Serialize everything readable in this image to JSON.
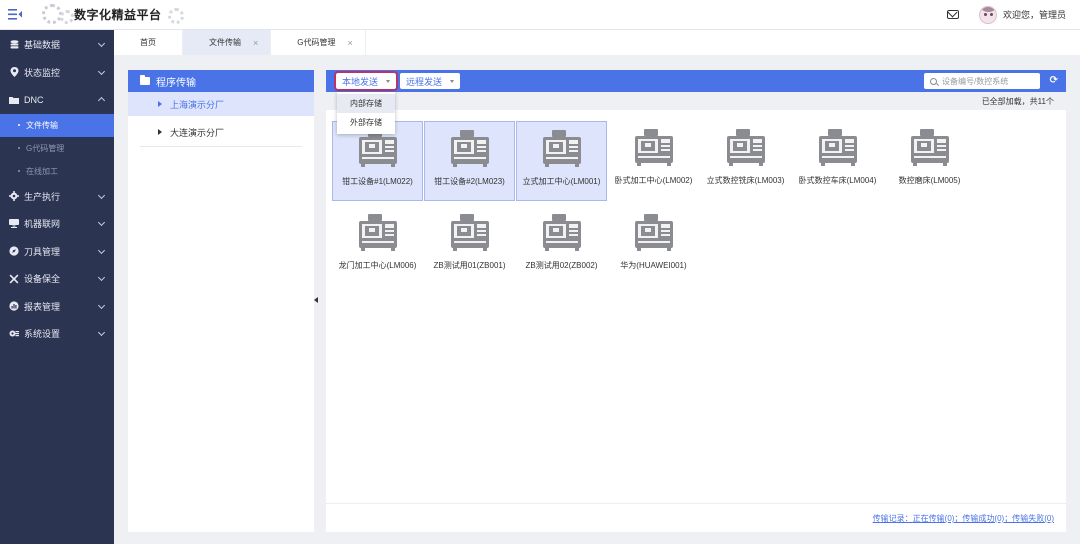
{
  "header": {
    "app_title": "数字化精益平台",
    "welcome": "欢迎您，管理员",
    "icons": {
      "menu": "menu-collapse-icon",
      "mail": "mail-icon",
      "avatar": "user-avatar"
    }
  },
  "sidebar": {
    "items": [
      {
        "label": "基础数据",
        "icon": "database-icon",
        "expanded": false
      },
      {
        "label": "状态监控",
        "icon": "location-pin-icon",
        "expanded": false
      },
      {
        "label": "DNC",
        "icon": "folder-icon",
        "expanded": true
      },
      {
        "label": "生产执行",
        "icon": "gear-icon",
        "expanded": false
      },
      {
        "label": "机器联网",
        "icon": "network-icon",
        "expanded": false
      },
      {
        "label": "刀具管理",
        "icon": "compass-icon",
        "expanded": false
      },
      {
        "label": "设备保全",
        "icon": "wrench-icon",
        "expanded": false
      },
      {
        "label": "报表管理",
        "icon": "chart-icon",
        "expanded": false
      },
      {
        "label": "系统设置",
        "icon": "settings-icon",
        "expanded": false
      }
    ],
    "dnc_sub": [
      {
        "label": "文件传输",
        "active": true
      },
      {
        "label": "G代码管理",
        "active": false
      },
      {
        "label": "在线加工",
        "active": false
      }
    ]
  },
  "tabs": [
    {
      "label": "首页",
      "closable": false,
      "active": false
    },
    {
      "label": "文件传输",
      "closable": true,
      "active": true
    },
    {
      "label": "G代码管理",
      "closable": true,
      "active": false
    }
  ],
  "tree": {
    "title": "程序传输",
    "nodes": [
      {
        "label": "上海演示分厂",
        "selected": true
      },
      {
        "label": "大连演示分厂",
        "selected": false
      }
    ]
  },
  "toolbar": {
    "local_send": "本地发送",
    "remote_send": "远程发送",
    "search_placeholder": "设备编号/数控系统",
    "dropdown_options": [
      "内部存储",
      "外部存储"
    ]
  },
  "status": {
    "loaded_text": "已全部加载，共11个"
  },
  "devices": [
    {
      "label": "钳工设备#1(LM022)",
      "selected": true
    },
    {
      "label": "钳工设备#2(LM023)",
      "selected": true
    },
    {
      "label": "立式加工中心(LM001)",
      "selected": true
    },
    {
      "label": "卧式加工中心(LM002)",
      "selected": false
    },
    {
      "label": "立式数控铣床(LM003)",
      "selected": false
    },
    {
      "label": "卧式数控车床(LM004)",
      "selected": false
    },
    {
      "label": "数控磨床(LM005)",
      "selected": false
    },
    {
      "label": "龙门加工中心(LM006)",
      "selected": false
    },
    {
      "label": "ZB测试用01(ZB001)",
      "selected": false
    },
    {
      "label": "ZB测试用02(ZB002)",
      "selected": false
    },
    {
      "label": "华为(HUAWEI001)",
      "selected": false
    }
  ],
  "footer": {
    "transfer_log": "传输记录：正在传输(0)；传输成功(0)；传输失败(0)"
  },
  "colors": {
    "primary": "#4a73e8",
    "sidebar_bg": "#2b3451",
    "highlight_border": "#b2356b"
  }
}
